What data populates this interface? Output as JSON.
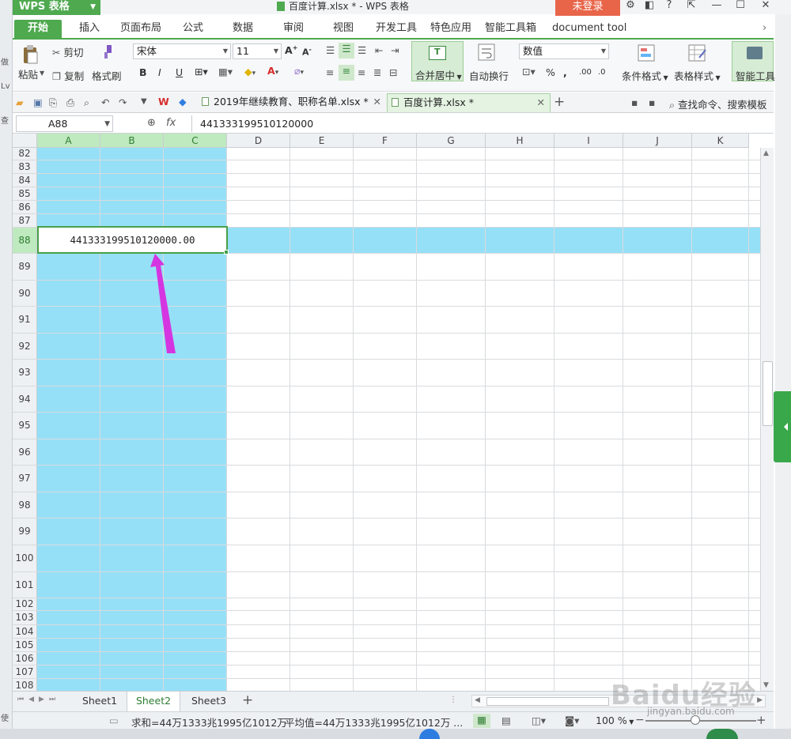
{
  "app": {
    "name": "WPS 表格",
    "window_title": "百度计算.xlsx * - WPS 表格",
    "login_label": "未登录"
  },
  "menu": {
    "tabs": [
      "开始",
      "插入",
      "页面布局",
      "公式",
      "数据",
      "审阅",
      "视图",
      "开发工具",
      "特色应用",
      "智能工具箱",
      "document tool"
    ],
    "active": "开始"
  },
  "ribbon": {
    "paste": "粘贴",
    "cut": "剪切",
    "copy": "复制",
    "format_painter": "格式刷",
    "font_name": "宋体",
    "font_size": "11",
    "merge_center": "合并居中",
    "wrap_text": "自动换行",
    "number_format": "数值",
    "percent": "%",
    "conditional_format": "条件格式",
    "table_style": "表格样式",
    "smart_tools": "智能工具"
  },
  "quickbar": {
    "doc_tabs": [
      {
        "label": "2019年继续教育、职称名单.xlsx *",
        "active": false
      },
      {
        "label": "百度计算.xlsx *",
        "active": true
      }
    ],
    "search_label": "查找命令、搜索模板"
  },
  "formula_bar": {
    "name_box": "A88",
    "fx": "fx",
    "content": "441333199510120000"
  },
  "grid": {
    "columns": [
      "A",
      "B",
      "C",
      "D",
      "E",
      "F",
      "G",
      "H",
      "I",
      "J",
      "K"
    ],
    "rows": [
      "82",
      "83",
      "84",
      "85",
      "86",
      "87",
      "88",
      "89",
      "90",
      "91",
      "92",
      "93",
      "94",
      "95",
      "96",
      "97",
      "98",
      "99",
      "100",
      "101",
      "102",
      "103",
      "104",
      "105",
      "106",
      "107",
      "108"
    ],
    "active_cell": "A88",
    "active_cell_value": "441333199510120000.00",
    "highlight_color": "#96e0f7",
    "selection_color": "#48a048"
  },
  "sheets": {
    "tabs": [
      "Sheet1",
      "Sheet2",
      "Sheet3"
    ],
    "active": "Sheet2"
  },
  "status": {
    "sum": "求和=44万1333兆1995亿1012万",
    "avg": "平均值=44万1333兆1995亿1012万 ...",
    "zoom": "100 %"
  },
  "watermark": {
    "text": "Baidu经验",
    "url": "jingyan.baidu.com"
  },
  "annotation": {
    "arrow_color": "#d535e0"
  },
  "left_edge_text": [
    "做",
    "Lv",
    "查",
    "使"
  ]
}
